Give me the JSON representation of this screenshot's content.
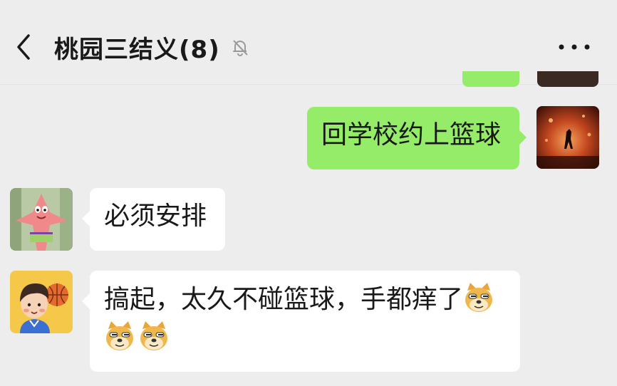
{
  "header": {
    "back_icon": "chevron-left-icon",
    "title": "桃园三结义(8)",
    "mute_icon": "bell-off-icon",
    "more_icon": "ellipsis-icon"
  },
  "messages": [
    {
      "direction": "sent",
      "text": "回学校约上篮球",
      "avatar": "fire-landscape-avatar"
    },
    {
      "direction": "received",
      "text": "必须安排",
      "avatar": "patrick-star-avatar"
    },
    {
      "direction": "received",
      "text": "搞起，太久不碰篮球，手都痒了",
      "emojis": [
        "doge-emoji",
        "doge-emoji",
        "doge-emoji"
      ],
      "avatar": "basketball-boy-avatar"
    }
  ],
  "colors": {
    "background": "#ededed",
    "sent_bubble": "#95ec69",
    "received_bubble": "#ffffff",
    "text": "#191919"
  }
}
